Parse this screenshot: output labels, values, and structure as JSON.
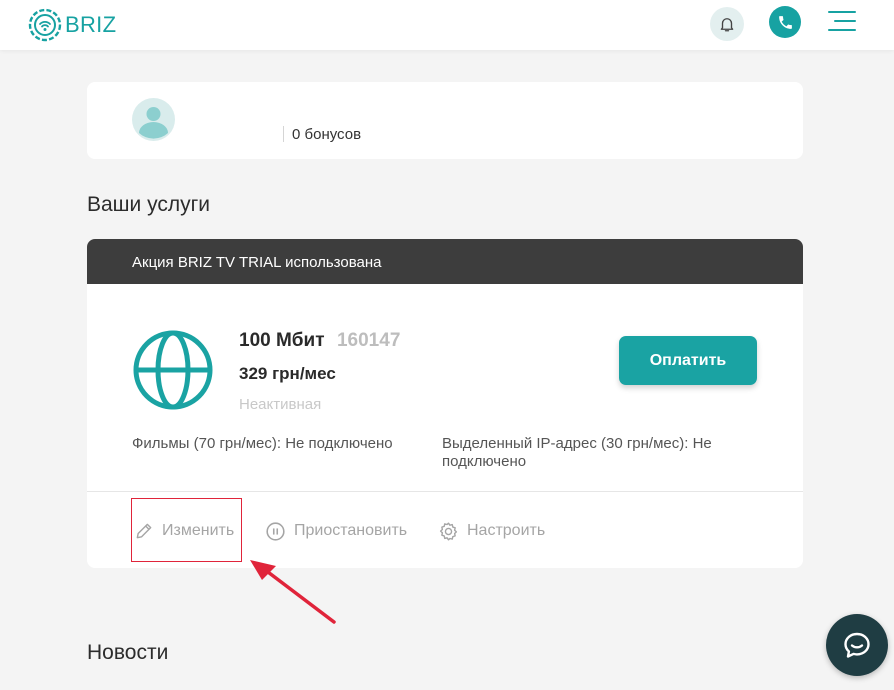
{
  "brand": {
    "name": "BRIZ",
    "color": "#17a2a2"
  },
  "header": {
    "bell_icon": "bell-icon",
    "phone_icon": "phone-icon",
    "menu_icon": "hamburger-menu-icon"
  },
  "profile": {
    "bonuses": "0 бонусов",
    "avatar_icon": "user-avatar-icon"
  },
  "services": {
    "title": "Ваши услуги",
    "promo": "Акция BRIZ TV TRIAL использована",
    "plan_name": "100 Мбит",
    "plan_id": "160147",
    "price": "329 грн/мес",
    "status": "Неактивная",
    "pay_label": "Оплатить",
    "addons": [
      {
        "text": "Фильмы (70 грн/мес): Не подключено"
      },
      {
        "text": "Выделенный IP-адрес (30 грн/мес): Не подключено"
      }
    ],
    "actions": {
      "edit": "Изменить",
      "pause": "Приостановить",
      "configure": "Настроить"
    }
  },
  "news": {
    "title": "Новости"
  },
  "colors": {
    "accent": "#1aa3a3",
    "promo_bar": "#3d3d3d",
    "highlight": "#e0243a",
    "chat": "#1f3d43"
  }
}
